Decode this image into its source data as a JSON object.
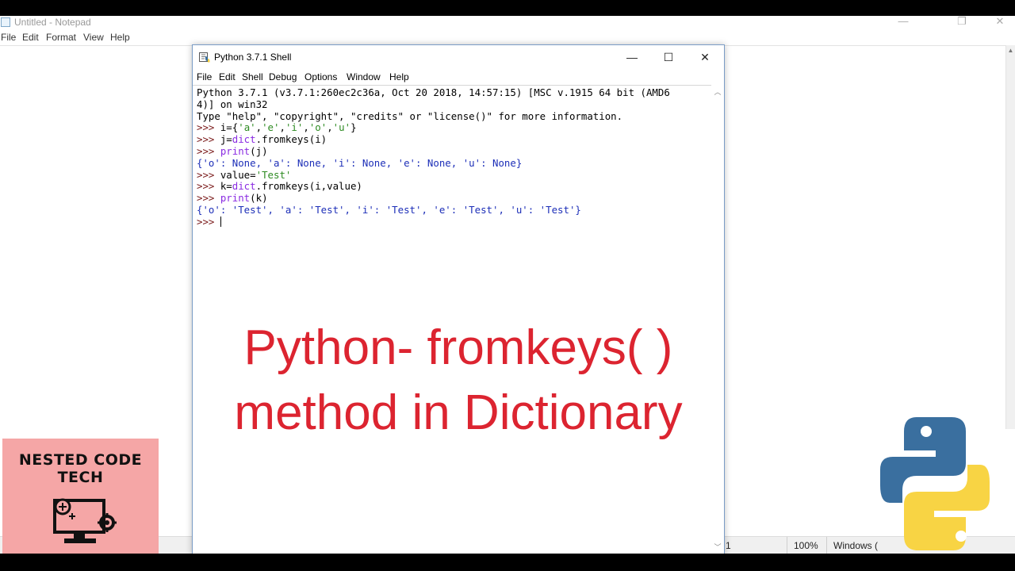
{
  "notepad": {
    "title": "Untitled - Notepad",
    "menu": [
      "File",
      "Edit",
      "Format",
      "View",
      "Help"
    ],
    "status_position": "1",
    "status_zoom": "100%",
    "status_line_ending": "Windows ("
  },
  "shell": {
    "title": "Python 3.7.1 Shell",
    "menu": [
      "File",
      "Edit",
      "Shell",
      "Debug",
      "Options",
      "Window",
      "Help"
    ],
    "lines": {
      "l1": "Python 3.7.1 (v3.7.1:260ec2c36a, Oct 20 2018, 14:57:15) [MSC v.1915 64 bit (AMD6",
      "l2": "4)] on win32",
      "l3": "Type \"help\", \"copyright\", \"credits\" or \"license()\" for more information.",
      "prompt": ">>> ",
      "i_pre": "i={",
      "i_vals": [
        "'a'",
        "'e'",
        "'i'",
        "'o'",
        "'u'"
      ],
      "i_post": "}",
      "j_pre": "j=",
      "j_kw": "dict",
      "j_post": ".fromkeys(i)",
      "print_kw": "print",
      "print_j": "(j)",
      "out_j": "{'o': None, 'a': None, 'i': None, 'e': None, 'u': None}",
      "value_pre": "value=",
      "value_str": "'Test'",
      "k_pre": "k=",
      "k_kw": "dict",
      "k_post": ".fromkeys(i,value)",
      "print_k": "(k)",
      "out_k": "{'o': 'Test', 'a': 'Test', 'i': 'Test', 'e': 'Test', 'u': 'Test'}"
    }
  },
  "overlay": {
    "line1": "Python- fromkeys( )",
    "line2": "method in Dictionary"
  },
  "brand": {
    "name": "NESTED CODE TECH"
  },
  "colors": {
    "overlay_text": "#dc2430",
    "brand_bg": "#f5a6a6",
    "python_blue": "#3a6f9f",
    "python_yellow": "#f8d444"
  },
  "icons": {
    "shell_window": "python-shell-icon",
    "brand_logo": "computer-gear-icon",
    "python_logo": "python-logo"
  }
}
